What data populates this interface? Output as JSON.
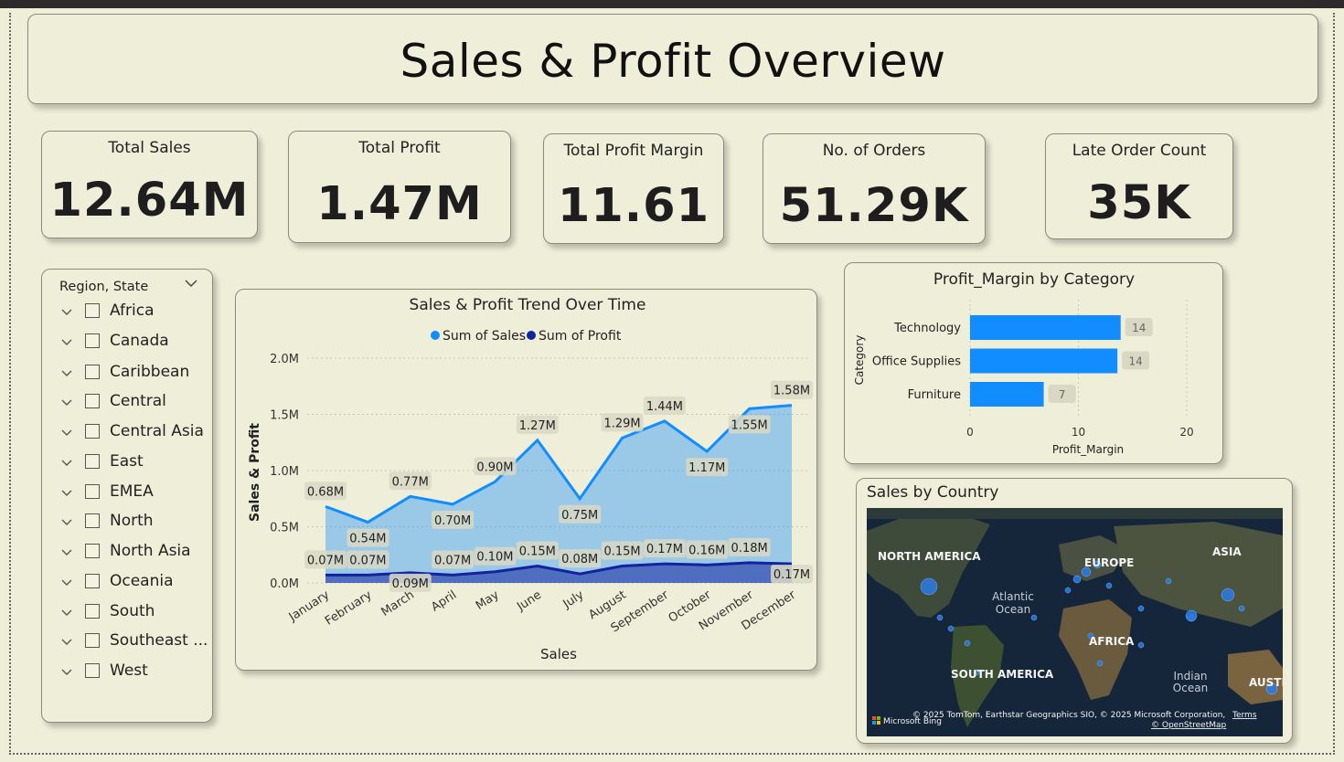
{
  "title": "Sales & Profit Overview",
  "kpis": [
    {
      "label": "Total Sales",
      "value": "12.64M"
    },
    {
      "label": "Total Profit",
      "value": "1.47M"
    },
    {
      "label": "Total Profit Margin",
      "value": "11.61"
    },
    {
      "label": "No. of Orders",
      "value": "51.29K"
    },
    {
      "label": "Late Order Count",
      "value": "35K"
    }
  ],
  "slicer": {
    "header": "Region, State",
    "items": [
      "Africa",
      "Canada",
      "Caribbean",
      "Central",
      "Central Asia",
      "East",
      "EMEA",
      "North",
      "North Asia",
      "Oceania",
      "South",
      "Southeast ...",
      "West"
    ]
  },
  "chart_data": [
    {
      "type": "area",
      "title": "Sales & Profit Trend Over Time",
      "xlabel": "Sales",
      "ylabel": "Sales & Profit",
      "legend_position": "top-center",
      "categories": [
        "January",
        "February",
        "March",
        "April",
        "May",
        "June",
        "July",
        "August",
        "September",
        "October",
        "November",
        "December"
      ],
      "yticks": [
        "0.0M",
        "0.5M",
        "1.0M",
        "1.5M",
        "2.0M"
      ],
      "ylim": [
        0,
        2.0
      ],
      "grid": true,
      "series": [
        {
          "name": "Sum of Sales",
          "color": "#118dff",
          "values": [
            0.68,
            0.54,
            0.77,
            0.7,
            0.9,
            1.27,
            0.75,
            1.29,
            1.44,
            1.17,
            1.55,
            1.58
          ],
          "labels": [
            "0.68M",
            "0.54M",
            "0.77M",
            "0.70M",
            "0.90M",
            "1.27M",
            "0.75M",
            "1.29M",
            "1.44M",
            "1.17M",
            "1.55M",
            "1.58M"
          ]
        },
        {
          "name": "Sum of Profit",
          "color": "#12239e",
          "values": [
            0.07,
            0.07,
            0.09,
            0.07,
            0.1,
            0.15,
            0.08,
            0.15,
            0.17,
            0.16,
            0.18,
            0.17
          ],
          "labels": [
            "0.07M",
            "0.07M",
            "0.09M",
            "0.07M",
            "0.10M",
            "0.15M",
            "0.08M",
            "0.15M",
            "0.17M",
            "0.16M",
            "0.18M",
            "0.17M"
          ]
        }
      ]
    },
    {
      "type": "bar",
      "orientation": "horizontal",
      "title": "Profit_Margin by Category",
      "xlabel": "Profit_Margin",
      "ylabel": "Category",
      "categories": [
        "Technology",
        "Office Supplies",
        "Furniture"
      ],
      "values": [
        14,
        14,
        7
      ],
      "display_values": [
        13.9,
        13.6,
        6.8
      ],
      "xlim": [
        0,
        20
      ],
      "xticks": [
        "0",
        "10",
        "20"
      ],
      "color": "#118dff"
    }
  ],
  "map": {
    "title": "Sales by Country",
    "labels": {
      "north_america": "NORTH AMERICA",
      "europe": "EUROPE",
      "asia": "ASIA",
      "atlantic": "Atlantic",
      "atlantic2": "Ocean",
      "africa": "AFRICA",
      "south_america": "SOUTH AMERICA",
      "indian": "Indian",
      "indian2": "Ocean",
      "australia": "AUSTR"
    },
    "attribution": "© 2025 TomTom, Earthstar Geographics SIO, © 2025 Microsoft Corporation,",
    "terms": "Terms",
    "osm": "© OpenStreetMap",
    "brand": "Microsoft Bing"
  }
}
